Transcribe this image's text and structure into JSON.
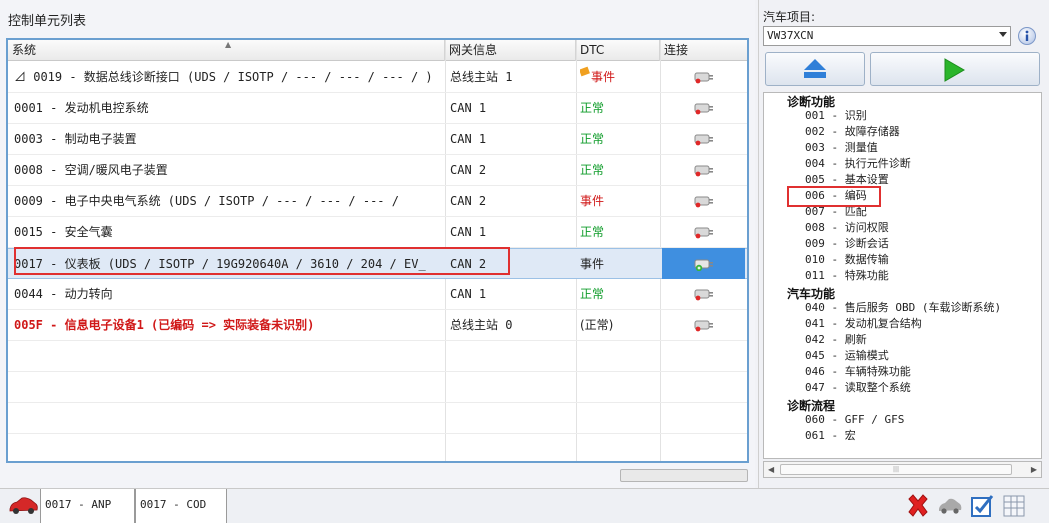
{
  "left_panel": {
    "title": "控制单元列表"
  },
  "table": {
    "columns": [
      "系统",
      "网关信息",
      "DTC",
      "连接"
    ],
    "rows": [
      {
        "system": "⊿ 0019 - 数据总线诊断接口  (UDS / ISOTP / --- / --- / --- / )",
        "gateway": "总线主站 1",
        "dtc": "事件",
        "dtc_status": "event",
        "dtc_flag": true
      },
      {
        "system": "0001 - 发动机电控系统",
        "gateway": "CAN 1",
        "dtc": "正常",
        "dtc_status": "ok"
      },
      {
        "system": "0003 - 制动电子装置",
        "gateway": "CAN 1",
        "dtc": "正常",
        "dtc_status": "ok"
      },
      {
        "system": "0008 - 空调/暖风电子装置",
        "gateway": "CAN 2",
        "dtc": "正常",
        "dtc_status": "ok"
      },
      {
        "system": "0009 - 电子中央电气系统  (UDS / ISOTP / --- / --- / --- /",
        "gateway": "CAN 2",
        "dtc": "事件",
        "dtc_status": "event"
      },
      {
        "system": "0015 - 安全气囊",
        "gateway": "CAN 1",
        "dtc": "正常",
        "dtc_status": "ok"
      },
      {
        "system": "0017 - 仪表板  (UDS / ISOTP / 19G920640A / 3610 / 204 / EV_",
        "gateway": "CAN 2",
        "dtc": "事件",
        "dtc_status": "neutral",
        "selected": true
      },
      {
        "system": "0044 - 动力转向",
        "gateway": "CAN 1",
        "dtc": "正常",
        "dtc_status": "ok"
      },
      {
        "system": "005F - 信息电子设备1  (已编码 => 实际装备未识别)",
        "gateway": "总线主站 0",
        "dtc": "(正常)",
        "dtc_status": "neutral",
        "red": true
      }
    ]
  },
  "bottom_tabs": [
    "0017 - ANP",
    "0017 - COD"
  ],
  "right_panel": {
    "project_label": "汽车项目:",
    "project_value": "VW37XCN",
    "sections": [
      {
        "title": "诊断功能",
        "items": [
          "001 - 识别",
          "002 - 故障存储器",
          "003 - 测量值",
          "004 - 执行元件诊断",
          "005 - 基本设置",
          "006 - 编码",
          "007 - 匹配",
          "008 - 访问权限",
          "009 - 诊断会话",
          "010 - 数据传输",
          "011 - 特殊功能"
        ]
      },
      {
        "title": "汽车功能",
        "items": [
          "040 - 售后服务 OBD (车载诊断系统)",
          "041 - 发动机复合结构",
          "042 - 刷新",
          "045 - 运输模式",
          "046 - 车辆特殊功能",
          "047 - 读取整个系统"
        ]
      },
      {
        "title": "诊断流程",
        "items": [
          "060 - GFF / GFS",
          "061 - 宏"
        ]
      }
    ]
  },
  "colors": {
    "ok": "#0f9c2a",
    "event": "#d01818",
    "highlight": "#e03030",
    "selected_conn": "#3f8fe0",
    "accent_green": "#2bb52b",
    "accent_blue": "#2f7fd8"
  },
  "icons": [
    "sort-arrow-icon",
    "flag-icon",
    "plug-icon",
    "connected-plug-icon",
    "car-icon",
    "eject-icon",
    "play-icon",
    "info-icon",
    "delete-x-icon",
    "car-gray-icon",
    "checkbox-icon",
    "grid-icon"
  ]
}
